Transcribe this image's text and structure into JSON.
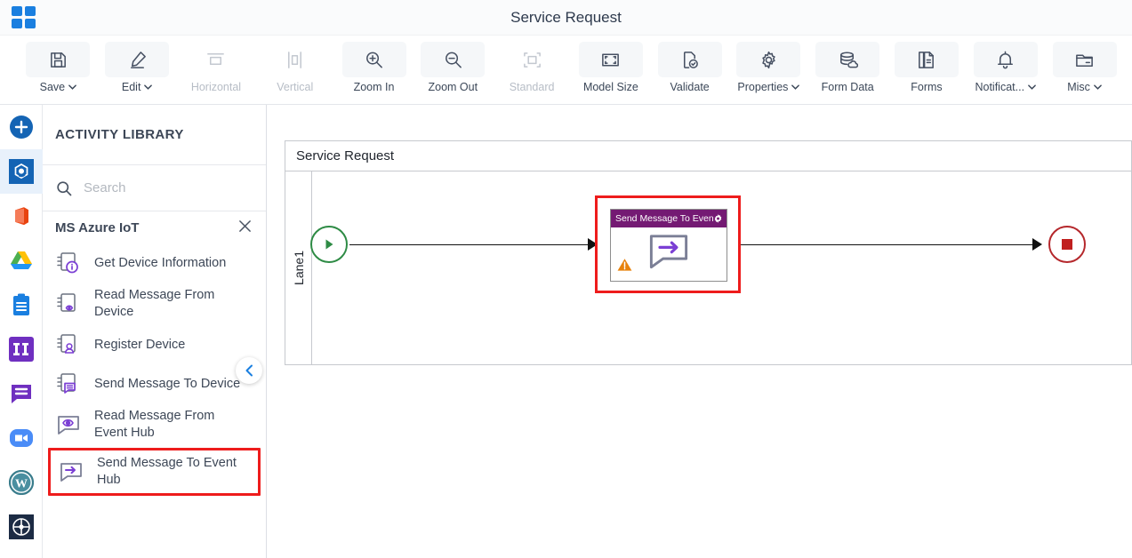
{
  "titlebar": {
    "app_title": "Service Request",
    "apps_icon": "apps-grid-icon"
  },
  "toolbar": {
    "items": [
      {
        "label": "Save",
        "icon": "save-icon",
        "caret": true,
        "disabled": false
      },
      {
        "label": "Edit",
        "icon": "pencil-icon",
        "caret": true,
        "disabled": false
      },
      {
        "label": "Horizontal",
        "icon": "horizontal-icon",
        "caret": false,
        "disabled": true
      },
      {
        "label": "Vertical",
        "icon": "vertical-icon",
        "caret": false,
        "disabled": true
      },
      {
        "label": "Zoom In",
        "icon": "zoom-in-icon",
        "caret": false,
        "disabled": false
      },
      {
        "label": "Zoom Out",
        "icon": "zoom-out-icon",
        "caret": false,
        "disabled": false
      },
      {
        "label": "Standard",
        "icon": "standard-icon",
        "caret": false,
        "disabled": true
      },
      {
        "label": "Model Size",
        "icon": "model-size-icon",
        "caret": false,
        "disabled": false
      },
      {
        "label": "Validate",
        "icon": "validate-icon",
        "caret": false,
        "disabled": false
      },
      {
        "label": "Properties",
        "icon": "gear-icon",
        "caret": true,
        "disabled": false
      },
      {
        "label": "Form Data",
        "icon": "database-icon",
        "caret": false,
        "disabled": false
      },
      {
        "label": "Forms",
        "icon": "document-icon",
        "caret": false,
        "disabled": false
      },
      {
        "label": "Notificat...",
        "icon": "bell-icon",
        "caret": true,
        "disabled": false
      },
      {
        "label": "Misc",
        "icon": "folder-icon",
        "caret": true,
        "disabled": false
      }
    ]
  },
  "rail": {
    "items": [
      {
        "name": "add-button",
        "icon": "plus-circle-icon",
        "selected": false
      },
      {
        "name": "integrations-app",
        "icon": "hexagon-node-icon",
        "selected": true
      },
      {
        "name": "office-app",
        "icon": "office-icon",
        "selected": false
      },
      {
        "name": "google-drive-app",
        "icon": "google-drive-icon",
        "selected": false
      },
      {
        "name": "clipboard-app",
        "icon": "clipboard-icon",
        "selected": false
      },
      {
        "name": "jira-app",
        "icon": "jira-icon",
        "selected": false
      },
      {
        "name": "chat-app",
        "icon": "chat-icon",
        "selected": false
      },
      {
        "name": "zoom-app",
        "icon": "video-camera-icon",
        "selected": false
      },
      {
        "name": "wordpress-app",
        "icon": "wordpress-icon",
        "selected": false
      },
      {
        "name": "more-apps",
        "icon": "grid-circle-icon",
        "selected": false
      }
    ]
  },
  "panel": {
    "title": "ACTIVITY LIBRARY",
    "search": {
      "placeholder": "Search",
      "value": "",
      "icon": "search-icon"
    },
    "group": {
      "name": "MS Azure IoT",
      "close_icon": "close-icon"
    },
    "activities": [
      {
        "label": "Get Device Information",
        "icon": "device-info-icon",
        "highlighted": false
      },
      {
        "label": "Read Message From Device",
        "icon": "device-read-icon",
        "highlighted": false
      },
      {
        "label": "Register Device",
        "icon": "device-user-icon",
        "highlighted": false
      },
      {
        "label": "Send Message To Device",
        "icon": "device-message-icon",
        "highlighted": false
      },
      {
        "label": "Read Message From Event Hub",
        "icon": "message-eye-icon",
        "highlighted": false
      },
      {
        "label": "Send Message To Event Hub",
        "icon": "message-arrow-icon",
        "highlighted": true
      }
    ],
    "collapse_icon": "chevron-left-icon"
  },
  "canvas": {
    "pool_title": "Service Request",
    "lane_label": "Lane1",
    "start_event": {
      "name": "start-event",
      "icon": "play-icon"
    },
    "end_event": {
      "name": "end-event",
      "icon": "stop-square-icon"
    },
    "task": {
      "title": "Send Message To Even...",
      "gear_icon": "gear-icon",
      "warning_icon": "warning-icon",
      "body_icon": "message-arrow-icon",
      "highlighted": true
    }
  },
  "colors": {
    "accent_blue": "#1a7fe0",
    "highlight_red": "#ee1c1c",
    "task_header_purple": "#741a73",
    "activity_icon_purple": "#7b3fd4",
    "start_green": "#2e8b45",
    "end_red": "#b5282c",
    "warning_orange": "#e8820c"
  }
}
